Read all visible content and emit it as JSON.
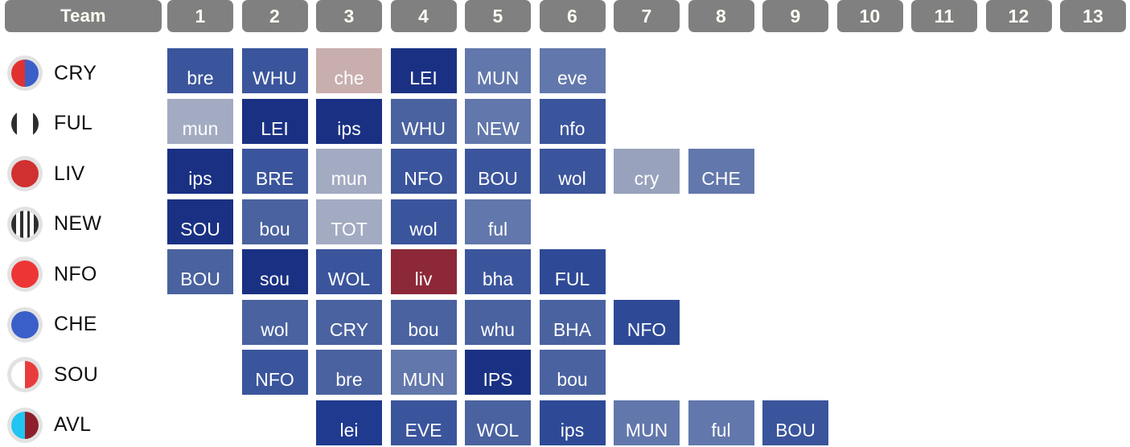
{
  "table": {
    "team_column_header": "Team",
    "gameweek_headers": [
      "1",
      "2",
      "3",
      "4",
      "5",
      "6",
      "7",
      "8",
      "9",
      "10",
      "11",
      "12",
      "13"
    ],
    "header_bg": "#808080",
    "header_text_color": "#fdfcf3"
  },
  "difficulty_colors": {
    "very_easy_navy": "#1a3183",
    "easy_blue": "#2e4a96",
    "standard_blue": "#3b559c",
    "medium_blue": "#4a629f",
    "mid_blue": "#6277ab",
    "light_blue": "#7184b4",
    "very_light_blue": "#a3abc2",
    "hard_pink": "#c9aeae",
    "very_hard_red": "#8d2838"
  },
  "rows": [
    {
      "team": "CRY",
      "badge": {
        "type": "split",
        "left": "#e03131",
        "right": "#3b5fc9"
      },
      "fixtures": [
        {
          "gw": 1,
          "label": "bre",
          "color": "#3b559c"
        },
        {
          "gw": 2,
          "label": "WHU",
          "color": "#3b559c"
        },
        {
          "gw": 3,
          "label": "che",
          "color": "#c9aeae"
        },
        {
          "gw": 4,
          "label": "LEI",
          "color": "#1a3183"
        },
        {
          "gw": 5,
          "label": "MUN",
          "color": "#6277ab"
        },
        {
          "gw": 6,
          "label": "eve",
          "color": "#6277ab"
        }
      ]
    },
    {
      "team": "FUL",
      "badge": {
        "type": "fulham",
        "edge": "#2e2e2e",
        "center": "#ffffff"
      },
      "fixtures": [
        {
          "gw": 1,
          "label": "mun",
          "color": "#a3abc2"
        },
        {
          "gw": 2,
          "label": "LEI",
          "color": "#1a3183"
        },
        {
          "gw": 3,
          "label": "ips",
          "color": "#1a3183"
        },
        {
          "gw": 4,
          "label": "WHU",
          "color": "#4a629f"
        },
        {
          "gw": 5,
          "label": "NEW",
          "color": "#6277ab"
        },
        {
          "gw": 6,
          "label": "nfo",
          "color": "#3b559c"
        }
      ]
    },
    {
      "team": "LIV",
      "badge": {
        "type": "solid",
        "color": "#d03030"
      },
      "fixtures": [
        {
          "gw": 1,
          "label": "ips",
          "color": "#1a3183"
        },
        {
          "gw": 2,
          "label": "BRE",
          "color": "#3b559c"
        },
        {
          "gw": 3,
          "label": "mun",
          "color": "#a3abc2"
        },
        {
          "gw": 4,
          "label": "NFO",
          "color": "#3b559c"
        },
        {
          "gw": 5,
          "label": "BOU",
          "color": "#3b559c"
        },
        {
          "gw": 6,
          "label": "wol",
          "color": "#3b559c"
        },
        {
          "gw": 7,
          "label": "cry",
          "color": "#98a2bc"
        },
        {
          "gw": 8,
          "label": "CHE",
          "color": "#6277ab"
        }
      ]
    },
    {
      "team": "NEW",
      "badge": {
        "type": "stripes",
        "dark": "#2e2e2e",
        "light": "#ffffff"
      },
      "fixtures": [
        {
          "gw": 1,
          "label": "SOU",
          "color": "#1a3183"
        },
        {
          "gw": 2,
          "label": "bou",
          "color": "#4a629f"
        },
        {
          "gw": 3,
          "label": "TOT",
          "color": "#a3abc2"
        },
        {
          "gw": 4,
          "label": "wol",
          "color": "#3b559c"
        },
        {
          "gw": 5,
          "label": "ful",
          "color": "#6277ab"
        }
      ]
    },
    {
      "team": "NFO",
      "badge": {
        "type": "solid",
        "color": "#ee3535"
      },
      "fixtures": [
        {
          "gw": 1,
          "label": "BOU",
          "color": "#4a629f"
        },
        {
          "gw": 2,
          "label": "sou",
          "color": "#1a3183"
        },
        {
          "gw": 3,
          "label": "WOL",
          "color": "#3b559c"
        },
        {
          "gw": 4,
          "label": "liv",
          "color": "#8d2838"
        },
        {
          "gw": 5,
          "label": "bha",
          "color": "#3b559c"
        },
        {
          "gw": 6,
          "label": "FUL",
          "color": "#2e4a96"
        }
      ]
    },
    {
      "team": "CHE",
      "badge": {
        "type": "solid",
        "color": "#3b5fc9"
      },
      "fixtures": [
        {
          "gw": 2,
          "label": "wol",
          "color": "#4a629f"
        },
        {
          "gw": 3,
          "label": "CRY",
          "color": "#4a629f"
        },
        {
          "gw": 4,
          "label": "bou",
          "color": "#4a629f"
        },
        {
          "gw": 5,
          "label": "whu",
          "color": "#4a629f"
        },
        {
          "gw": 6,
          "label": "BHA",
          "color": "#4a629f"
        },
        {
          "gw": 7,
          "label": "NFO",
          "color": "#2e4a96"
        }
      ]
    },
    {
      "team": "SOU",
      "badge": {
        "type": "split",
        "left": "#ffffff",
        "right": "#e83c3c"
      },
      "fixtures": [
        {
          "gw": 2,
          "label": "NFO",
          "color": "#3b559c"
        },
        {
          "gw": 3,
          "label": "bre",
          "color": "#4a629f"
        },
        {
          "gw": 4,
          "label": "MUN",
          "color": "#6277ab"
        },
        {
          "gw": 5,
          "label": "IPS",
          "color": "#1a3183"
        },
        {
          "gw": 6,
          "label": "bou",
          "color": "#4a629f"
        }
      ]
    },
    {
      "team": "AVL",
      "badge": {
        "type": "split",
        "left": "#20c4f0",
        "right": "#8d1f2b"
      },
      "fixtures": [
        {
          "gw": 3,
          "label": "lei",
          "color": "#1f3a8f"
        },
        {
          "gw": 4,
          "label": "EVE",
          "color": "#3b559c"
        },
        {
          "gw": 5,
          "label": "WOL",
          "color": "#4a629f"
        },
        {
          "gw": 6,
          "label": "ips",
          "color": "#2e4a96"
        },
        {
          "gw": 7,
          "label": "MUN",
          "color": "#6277ab"
        },
        {
          "gw": 8,
          "label": "ful",
          "color": "#6277ab"
        },
        {
          "gw": 9,
          "label": "BOU",
          "color": "#3b559c"
        }
      ]
    }
  ]
}
